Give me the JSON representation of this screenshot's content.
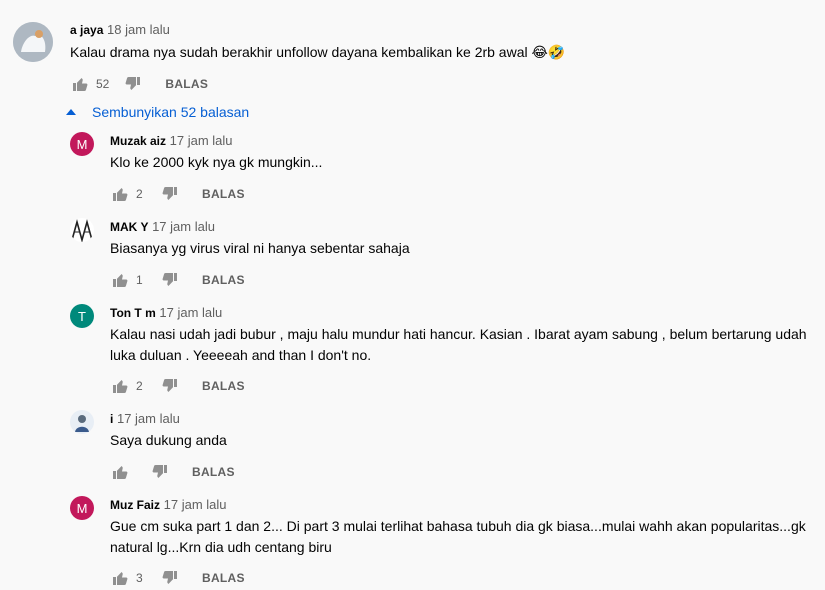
{
  "top_comment": {
    "author": "a            jaya",
    "time": "18 jam lalu",
    "text": "Kalau drama nya sudah berakhir unfollow dayana kembalikan ke 2rb awal 😂🤣",
    "likes": "52",
    "reply_label": "BALAS"
  },
  "hide_replies_label": "Sembunyikan 52 balasan",
  "replies": [
    {
      "author": "Muzak    aiz",
      "avatar_letter": "M",
      "avatar_color": "#c2185b",
      "time": "17 jam lalu",
      "text": "Klo ke 2000 kyk nya gk mungkin...",
      "likes": "2",
      "reply_label": "BALAS"
    },
    {
      "author": "               MAK    Y",
      "avatar_letter": "",
      "avatar_color": "#ffffff",
      "time": "17 jam lalu",
      "text": "Biasanya yg virus viral ni hanya sebentar sahaja",
      "likes": "1",
      "reply_label": "BALAS"
    },
    {
      "author": "Ton  T   m",
      "avatar_letter": "T",
      "avatar_color": "#00897b",
      "time": "17 jam lalu",
      "text": "Kalau nasi udah jadi bubur , maju halu mundur hati hancur. Kasian . Ibarat ayam sabung , belum bertarung udah luka duluan . Yeeeeah and than I don't no.",
      "likes": "2",
      "reply_label": "BALAS"
    },
    {
      "author": "     i",
      "avatar_letter": "",
      "avatar_color": "#e8eef5",
      "time": "17 jam lalu",
      "text": "Saya dukung anda",
      "likes": "",
      "reply_label": "BALAS"
    },
    {
      "author": "Muz      Faiz",
      "avatar_letter": "M",
      "avatar_color": "#c2185b",
      "time": "17 jam lalu",
      "text": "Gue cm suka part 1 dan 2... Di part 3 mulai terlihat bahasa tubuh dia gk biasa...mulai wahh akan popularitas...gk natural lg...Krn dia udh centang biru",
      "likes": "3",
      "reply_label": "BALAS"
    }
  ]
}
